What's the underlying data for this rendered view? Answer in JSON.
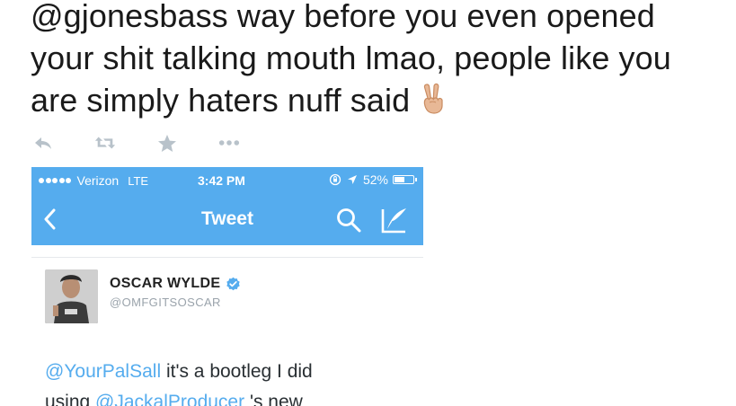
{
  "tweet": {
    "lines": [
      "@gjonesbass way before you even opened",
      "your shit talking mouth lmao, people like you",
      "are simply haters nuff said"
    ],
    "emoji": "victory-hand-emoji"
  },
  "actions": {
    "icons": [
      "reply-icon",
      "retweet-icon",
      "favorite-star-icon",
      "more-dots-icon"
    ]
  },
  "screenshot": {
    "status_bar": {
      "carrier": "Verizon",
      "network": "LTE",
      "time": "3:42 PM",
      "battery": "52%",
      "battery_level": 0.52
    },
    "nav": {
      "title": "Tweet"
    },
    "author": {
      "name": "OSCAR WYLDE",
      "handle": "@OMFGITSOSCAR"
    },
    "body": {
      "mention1": "@YourPalSall",
      "text1": " it's a bootleg I did",
      "text2_prefix": "using ",
      "mention2": "@JackalProducer",
      "text2_suffix": " 's new"
    },
    "colors": {
      "twitter_blue": "#55acee",
      "icon_gray": "#b8c2ca"
    }
  }
}
